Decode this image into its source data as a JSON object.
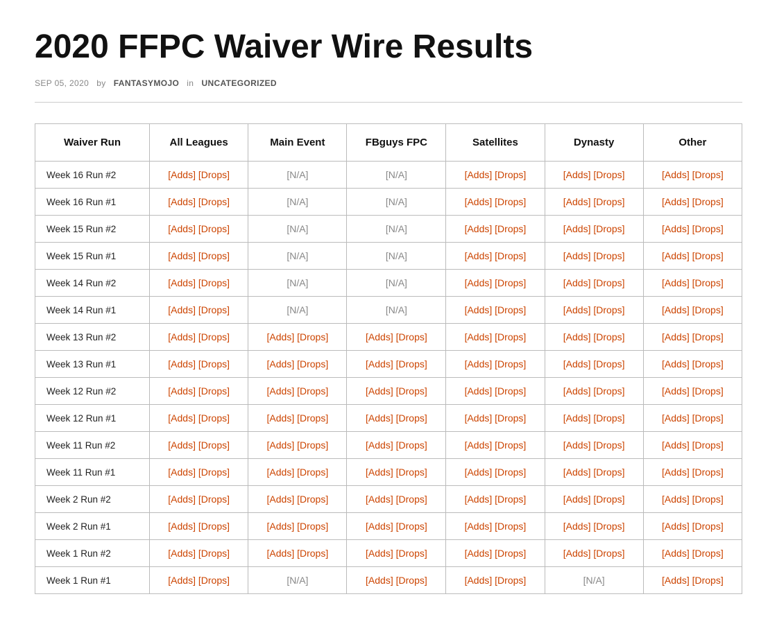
{
  "page": {
    "title": "2020 FFPC Waiver Wire Results",
    "meta": {
      "date": "SEP 05, 2020",
      "by_label": "by",
      "author": "FANTASYMOJO",
      "in_label": "in",
      "category": "UNCATEGORIZED"
    }
  },
  "table": {
    "headers": [
      "Waiver Run",
      "All Leagues",
      "Main Event",
      "FBguys FPC",
      "Satellites",
      "Dynasty",
      "Other"
    ],
    "rows": [
      {
        "label": "Week 16 Run #2",
        "all_leagues": {
          "adds": "[Adds]",
          "drops": "[Drops]",
          "na": false
        },
        "main_event": {
          "na": true,
          "na_text": "[N/A]"
        },
        "fbguys": {
          "na": true,
          "na_text": "[N/A]"
        },
        "satellites": {
          "adds": "[Adds]",
          "drops": "[Drops]",
          "na": false
        },
        "dynasty": {
          "adds": "[Adds]",
          "drops": "[Drops]",
          "na": false
        },
        "other": {
          "adds": "[Adds]",
          "drops": "[Drops]",
          "na": false
        }
      },
      {
        "label": "Week 16 Run #1",
        "all_leagues": {
          "adds": "[Adds]",
          "drops": "[Drops]",
          "na": false
        },
        "main_event": {
          "na": true,
          "na_text": "[N/A]"
        },
        "fbguys": {
          "na": true,
          "na_text": "[N/A]"
        },
        "satellites": {
          "adds": "[Adds]",
          "drops": "[Drops]",
          "na": false
        },
        "dynasty": {
          "adds": "[Adds]",
          "drops": "[Drops]",
          "na": false
        },
        "other": {
          "adds": "[Adds]",
          "drops": "[Drops]",
          "na": false
        }
      },
      {
        "label": "Week 15 Run #2",
        "all_leagues": {
          "adds": "[Adds]",
          "drops": "[Drops]",
          "na": false
        },
        "main_event": {
          "na": true,
          "na_text": "[N/A]"
        },
        "fbguys": {
          "na": true,
          "na_text": "[N/A]"
        },
        "satellites": {
          "adds": "[Adds]",
          "drops": "[Drops]",
          "na": false
        },
        "dynasty": {
          "adds": "[Adds]",
          "drops": "[Drops]",
          "na": false
        },
        "other": {
          "adds": "[Adds]",
          "drops": "[Drops]",
          "na": false
        }
      },
      {
        "label": "Week 15 Run #1",
        "all_leagues": {
          "adds": "[Adds]",
          "drops": "[Drops]",
          "na": false
        },
        "main_event": {
          "na": true,
          "na_text": "[N/A]"
        },
        "fbguys": {
          "na": true,
          "na_text": "[N/A]"
        },
        "satellites": {
          "adds": "[Adds]",
          "drops": "[Drops]",
          "na": false
        },
        "dynasty": {
          "adds": "[Adds]",
          "drops": "[Drops]",
          "na": false
        },
        "other": {
          "adds": "[Adds]",
          "drops": "[Drops]",
          "na": false
        }
      },
      {
        "label": "Week 14 Run #2",
        "all_leagues": {
          "adds": "[Adds]",
          "drops": "[Drops]",
          "na": false
        },
        "main_event": {
          "na": true,
          "na_text": "[N/A]"
        },
        "fbguys": {
          "na": true,
          "na_text": "[N/A]"
        },
        "satellites": {
          "adds": "[Adds]",
          "drops": "[Drops]",
          "na": false
        },
        "dynasty": {
          "adds": "[Adds]",
          "drops": "[Drops]",
          "na": false
        },
        "other": {
          "adds": "[Adds]",
          "drops": "[Drops]",
          "na": false
        }
      },
      {
        "label": "Week 14 Run #1",
        "all_leagues": {
          "adds": "[Adds]",
          "drops": "[Drops]",
          "na": false
        },
        "main_event": {
          "na": true,
          "na_text": "[N/A]"
        },
        "fbguys": {
          "na": true,
          "na_text": "[N/A]"
        },
        "satellites": {
          "adds": "[Adds]",
          "drops": "[Drops]",
          "na": false
        },
        "dynasty": {
          "adds": "[Adds]",
          "drops": "[Drops]",
          "na": false
        },
        "other": {
          "adds": "[Adds]",
          "drops": "[Drops]",
          "na": false
        }
      },
      {
        "label": "Week 13 Run #2",
        "all_leagues": {
          "adds": "[Adds]",
          "drops": "[Drops]",
          "na": false
        },
        "main_event": {
          "adds": "[Adds]",
          "drops": "[Drops]",
          "na": false
        },
        "fbguys": {
          "adds": "[Adds]",
          "drops": "[Drops]",
          "na": false
        },
        "satellites": {
          "adds": "[Adds]",
          "drops": "[Drops]",
          "na": false
        },
        "dynasty": {
          "adds": "[Adds]",
          "drops": "[Drops]",
          "na": false
        },
        "other": {
          "adds": "[Adds]",
          "drops": "[Drops]",
          "na": false
        }
      },
      {
        "label": "Week 13 Run #1",
        "all_leagues": {
          "adds": "[Adds]",
          "drops": "[Drops]",
          "na": false
        },
        "main_event": {
          "adds": "[Adds]",
          "drops": "[Drops]",
          "na": false
        },
        "fbguys": {
          "adds": "[Adds]",
          "drops": "[Drops]",
          "na": false
        },
        "satellites": {
          "adds": "[Adds]",
          "drops": "[Drops]",
          "na": false
        },
        "dynasty": {
          "adds": "[Adds]",
          "drops": "[Drops]",
          "na": false
        },
        "other": {
          "adds": "[Adds]",
          "drops": "[Drops]",
          "na": false
        }
      },
      {
        "label": "Week 12 Run #2",
        "all_leagues": {
          "adds": "[Adds]",
          "drops": "[Drops]",
          "na": false
        },
        "main_event": {
          "adds": "[Adds]",
          "drops": "[Drops]",
          "na": false
        },
        "fbguys": {
          "adds": "[Adds]",
          "drops": "[Drops]",
          "na": false
        },
        "satellites": {
          "adds": "[Adds]",
          "drops": "[Drops]",
          "na": false
        },
        "dynasty": {
          "adds": "[Adds]",
          "drops": "[Drops]",
          "na": false
        },
        "other": {
          "adds": "[Adds]",
          "drops": "[Drops]",
          "na": false
        }
      },
      {
        "label": "Week 12 Run #1",
        "all_leagues": {
          "adds": "[Adds]",
          "drops": "[Drops]",
          "na": false
        },
        "main_event": {
          "adds": "[Adds]",
          "drops": "[Drops]",
          "na": false
        },
        "fbguys": {
          "adds": "[Adds]",
          "drops": "[Drops]",
          "na": false
        },
        "satellites": {
          "adds": "[Adds]",
          "drops": "[Drops]",
          "na": false
        },
        "dynasty": {
          "adds": "[Adds]",
          "drops": "[Drops]",
          "na": false
        },
        "other": {
          "adds": "[Adds]",
          "drops": "[Drops]",
          "na": false
        }
      },
      {
        "label": "Week 11 Run #2",
        "all_leagues": {
          "adds": "[Adds]",
          "drops": "[Drops]",
          "na": false
        },
        "main_event": {
          "adds": "[Adds]",
          "drops": "[Drops]",
          "na": false
        },
        "fbguys": {
          "adds": "[Adds]",
          "drops": "[Drops]",
          "na": false
        },
        "satellites": {
          "adds": "[Adds]",
          "drops": "[Drops]",
          "na": false
        },
        "dynasty": {
          "adds": "[Adds]",
          "drops": "[Drops]",
          "na": false
        },
        "other": {
          "adds": "[Adds]",
          "drops": "[Drops]",
          "na": false
        }
      },
      {
        "label": "Week 11 Run #1",
        "all_leagues": {
          "adds": "[Adds]",
          "drops": "[Drops]",
          "na": false
        },
        "main_event": {
          "adds": "[Adds]",
          "drops": "[Drops]",
          "na": false
        },
        "fbguys": {
          "adds": "[Adds]",
          "drops": "[Drops]",
          "na": false
        },
        "satellites": {
          "adds": "[Adds]",
          "drops": "[Drops]",
          "na": false
        },
        "dynasty": {
          "adds": "[Adds]",
          "drops": "[Drops]",
          "na": false
        },
        "other": {
          "adds": "[Adds]",
          "drops": "[Drops]",
          "na": false
        }
      },
      {
        "label": "Week 2 Run #2",
        "all_leagues": {
          "adds": "[Adds]",
          "drops": "[Drops]",
          "na": false
        },
        "main_event": {
          "adds": "[Adds]",
          "drops": "[Drops]",
          "na": false
        },
        "fbguys": {
          "adds": "[Adds]",
          "drops": "[Drops]",
          "na": false
        },
        "satellites": {
          "adds": "[Adds]",
          "drops": "[Drops]",
          "na": false
        },
        "dynasty": {
          "adds": "[Adds]",
          "drops": "[Drops]",
          "na": false
        },
        "other": {
          "adds": "[Adds]",
          "drops": "[Drops]",
          "na": false
        }
      },
      {
        "label": "Week 2 Run #1",
        "all_leagues": {
          "adds": "[Adds]",
          "drops": "[Drops]",
          "na": false
        },
        "main_event": {
          "adds": "[Adds]",
          "drops": "[Drops]",
          "na": false
        },
        "fbguys": {
          "adds": "[Adds]",
          "drops": "[Drops]",
          "na": false
        },
        "satellites": {
          "adds": "[Adds]",
          "drops": "[Drops]",
          "na": false
        },
        "dynasty": {
          "adds": "[Adds]",
          "drops": "[Drops]",
          "na": false
        },
        "other": {
          "adds": "[Adds]",
          "drops": "[Drops]",
          "na": false
        }
      },
      {
        "label": "Week 1 Run #2",
        "all_leagues": {
          "adds": "[Adds]",
          "drops": "[Drops]",
          "na": false
        },
        "main_event": {
          "adds": "[Adds]",
          "drops": "[Drops]",
          "na": false
        },
        "fbguys": {
          "adds": "[Adds]",
          "drops": "[Drops]",
          "na": false
        },
        "satellites": {
          "adds": "[Adds]",
          "drops": "[Drops]",
          "na": false
        },
        "dynasty": {
          "adds": "[Adds]",
          "drops": "[Drops]",
          "na": false
        },
        "other": {
          "adds": "[Adds]",
          "drops": "[Drops]",
          "na": false
        }
      },
      {
        "label": "Week 1 Run #1",
        "all_leagues": {
          "adds": "[Adds]",
          "drops": "[Drops]",
          "na": false
        },
        "main_event": {
          "na": true,
          "na_text": "[N/A]"
        },
        "fbguys": {
          "adds": "[Adds]",
          "drops": "[Drops]",
          "na": false
        },
        "satellites": {
          "adds": "[Adds]",
          "drops": "[Drops]",
          "na": false
        },
        "dynasty": {
          "na": true,
          "na_text": "[N/A]"
        },
        "other": {
          "adds": "[Adds]",
          "drops": "[Drops]",
          "na": false
        }
      }
    ]
  }
}
